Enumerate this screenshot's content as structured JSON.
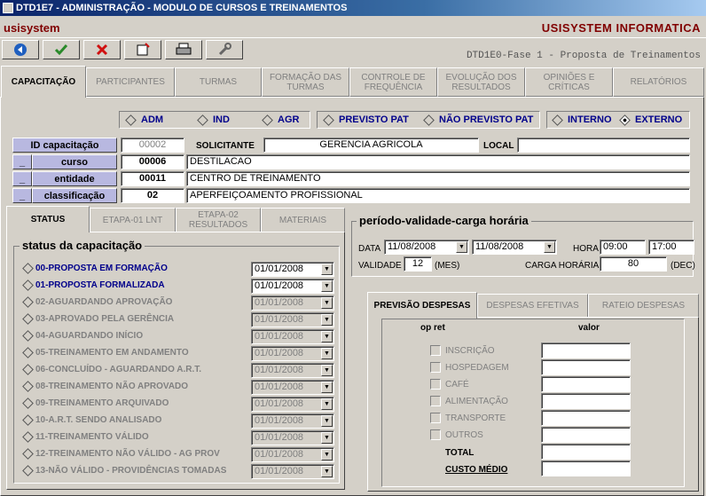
{
  "window": {
    "title": "DTD1E7 - ADMINISTRAÇÃO - MODULO DE CURSOS E TREINAMENTOS"
  },
  "brand": {
    "left": "usisystem",
    "right": "USISYSTEM INFORMATICA"
  },
  "toolbar": {
    "subtitle": "DTD1E0-Fase 1 - Proposta de Treinamentos"
  },
  "main_tabs": [
    "CAPACITAÇÃO",
    "PARTICIPANTES",
    "TURMAS",
    "FORMAÇÃO DAS TURMAS",
    "CONTROLE DE FREQUÊNCIA",
    "EVOLUÇÃO DOS RESULTADOS",
    "OPINIÕES E CRÍTICAS",
    "RELATÓRIOS"
  ],
  "options": {
    "adm": "ADM",
    "ind": "IND",
    "agr": "AGR",
    "previsto": "PREVISTO PAT",
    "nao_previsto": "NÃO PREVISTO PAT",
    "interno": "INTERNO",
    "externo": "EXTERNO"
  },
  "form": {
    "id_label": "ID capacitação",
    "id_value": "00002",
    "solicitante_label": "SOLICITANTE",
    "solicitante_value": "GERENCIA AGRICOLA",
    "local_label": "LOCAL",
    "local_value": "",
    "curso_label": "curso",
    "curso_code": "00006",
    "curso_name": "DESTILACAO",
    "entidade_label": "entidade",
    "entidade_code": "00011",
    "entidade_name": "CENTRO DE TREINAMENTO",
    "classificacao_label": "classificação",
    "classificacao_code": "02",
    "classificacao_name": "APERFEIÇOAMENTO PROFISSIONAL",
    "lookup_btn": "_"
  },
  "status_tabs": [
    "STATUS",
    "ETAPA-01 LNT",
    "ETAPA-02 RESULTADOS",
    "MATERIAIS"
  ],
  "status": {
    "title": "status da capacitação",
    "rows": [
      {
        "label": "00-PROPOSTA EM FORMAÇÃO",
        "date": "01/01/2008"
      },
      {
        "label": "01-PROPOSTA FORMALIZADA",
        "date": "01/01/2008"
      },
      {
        "label": "02-AGUARDANDO APROVAÇÃO",
        "date": "01/01/2008"
      },
      {
        "label": "03-APROVADO PELA GERÊNCIA",
        "date": "01/01/2008"
      },
      {
        "label": "04-AGUARDANDO INÍCIO",
        "date": "01/01/2008"
      },
      {
        "label": "05-TREINAMENTO EM ANDAMENTO",
        "date": "01/01/2008"
      },
      {
        "label": "06-CONCLUÍDO - AGUARDANDO A.R.T.",
        "date": "01/01/2008"
      },
      {
        "label": "08-TREINAMENTO NÃO APROVADO",
        "date": "01/01/2008"
      },
      {
        "label": "09-TREINAMENTO ARQUIVADO",
        "date": "01/01/2008"
      },
      {
        "label": "10-A.R.T. SENDO ANALISADO",
        "date": "01/01/2008"
      },
      {
        "label": "11-TREINAMENTO VÁLIDO",
        "date": "01/01/2008"
      },
      {
        "label": "12-TREINAMENTO NÃO VÁLIDO - AG PROV",
        "date": "01/01/2008"
      },
      {
        "label": "13-NÃO VÁLIDO - PROVIDÊNCIAS TOMADAS",
        "date": "01/01/2008"
      }
    ]
  },
  "period": {
    "title": "período-validade-carga horária",
    "data_label": "DATA",
    "date_start": "11/08/2008",
    "date_end": "11/08/2008",
    "hora_label": "HORA",
    "hora_start": "09:00",
    "hora_end": "17:00",
    "validade_label": "VALIDADE",
    "validade_value": "12",
    "validade_unit": "(MES)",
    "carga_label": "CARGA HORÁRIA",
    "carga_value": "80",
    "carga_unit": "(DEC)"
  },
  "previsao_tabs": [
    "PREVISÃO DESPESAS",
    "DESPESAS EFETIVAS",
    "RATEIO DESPESAS"
  ],
  "previsao": {
    "op_ret": "op ret",
    "valor": "valor",
    "items": [
      "INSCRIÇÃO",
      "HOSPEDAGEM",
      "CAFÉ",
      "ALIMENTAÇÃO",
      "TRANSPORTE",
      "OUTROS"
    ],
    "total": "TOTAL",
    "custo_medio": "CUSTO MÉDIO"
  }
}
